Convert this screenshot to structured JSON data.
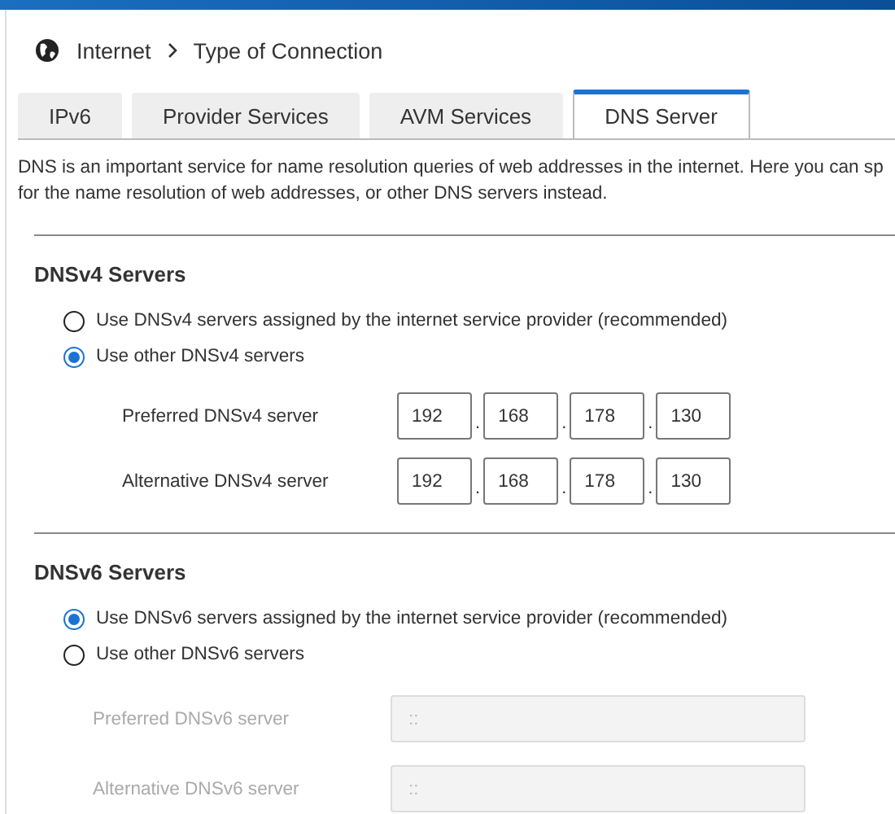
{
  "breadcrumb": [
    "Internet",
    "Type of Connection"
  ],
  "tabs": [
    {
      "label": "IPv6",
      "selected": false
    },
    {
      "label": "Provider Services",
      "selected": false
    },
    {
      "label": "AVM Services",
      "selected": false
    },
    {
      "label": "DNS Server",
      "selected": true
    }
  ],
  "description": "DNS is an important service for name resolution queries of web addresses in the internet. Here you can sp\nfor the name resolution of web addresses, or other DNS servers instead.",
  "sections": [
    {
      "kind": "ipv4",
      "title": "DNSv4 Servers",
      "options": [
        {
          "label": "Use DNSv4 servers assigned by the internet service provider (recommended)",
          "selected": false
        },
        {
          "label": "Use other DNSv4 servers",
          "selected": true
        }
      ],
      "fields": [
        {
          "label": "Preferred DNSv4 server",
          "disabled": false,
          "separator": ".",
          "octets": [
            "192",
            "168",
            "178",
            "130"
          ]
        },
        {
          "label": "Alternative DNSv4 server",
          "disabled": false,
          "separator": ".",
          "octets": [
            "192",
            "168",
            "178",
            "130"
          ]
        }
      ]
    },
    {
      "kind": "ipv6",
      "title": "DNSv6 Servers",
      "options": [
        {
          "label": "Use DNSv6 servers assigned by the internet service provider (recommended)",
          "selected": true
        },
        {
          "label": "Use other DNSv6 servers",
          "selected": false
        }
      ],
      "fields": [
        {
          "label": "Preferred DNSv6 server",
          "disabled": true,
          "placeholder": "::"
        },
        {
          "label": "Alternative DNSv6 server",
          "disabled": true,
          "placeholder": "::"
        }
      ]
    }
  ]
}
